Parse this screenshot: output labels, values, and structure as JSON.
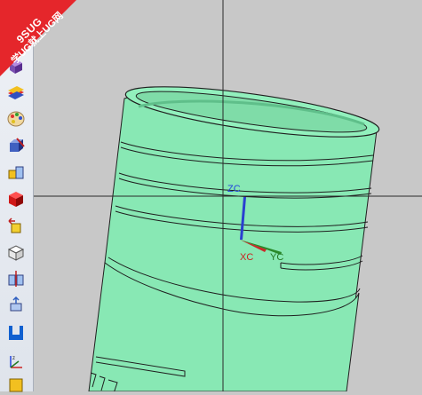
{
  "watermark": {
    "line1": "9SUG",
    "line2": "学UG就上UG网"
  },
  "csys": {
    "zc_label": "ZC",
    "xc_label": "XC",
    "yc_label": "YC",
    "zc_color": "#2244dd",
    "xc_color": "#cc2222",
    "yc_color": "#227722"
  },
  "colors": {
    "background": "#c8c8c8",
    "part_body": "#88e8b4",
    "part_edge": "#1f1f1f",
    "crosshair": "#2a2a2a"
  },
  "toolbar": {
    "tools": [
      {
        "name": "render-style-icon"
      },
      {
        "name": "layer-color-icon"
      },
      {
        "name": "palette-icon"
      },
      {
        "name": "edit-object-display-icon"
      },
      {
        "name": "show-hide-icon"
      },
      {
        "name": "cube-solid-icon"
      },
      {
        "name": "move-object-icon"
      },
      {
        "name": "box-icon"
      },
      {
        "name": "split-body-icon"
      },
      {
        "name": "offset-face-icon"
      },
      {
        "name": "groove-icon"
      },
      {
        "name": "wcs-icon"
      },
      {
        "name": "more-tools-icon"
      }
    ]
  }
}
